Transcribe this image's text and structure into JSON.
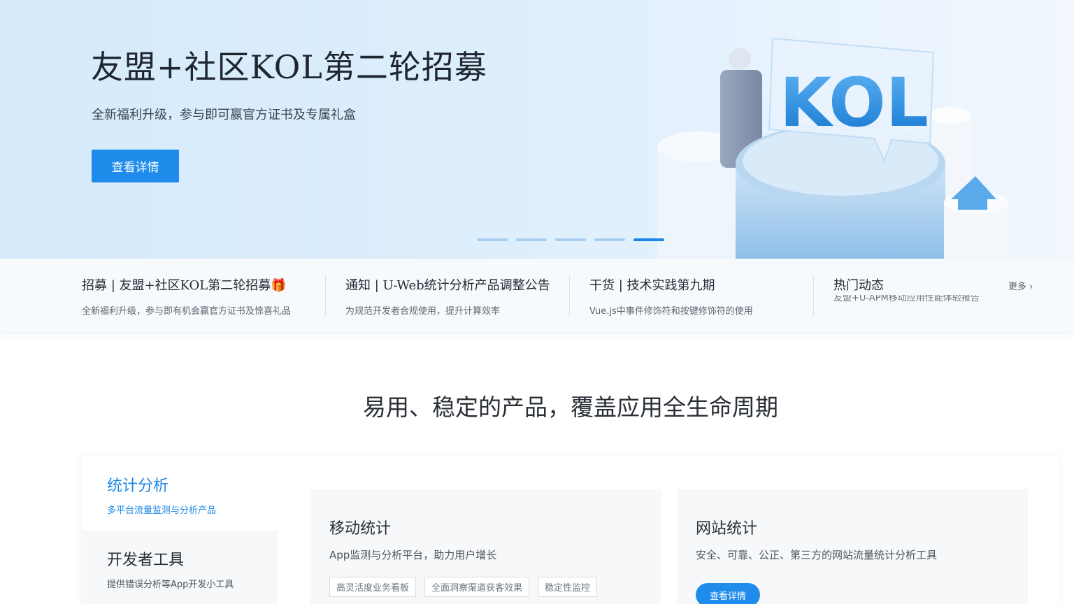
{
  "hero": {
    "title": "友盟+社区KOL第二轮招募",
    "subtitle": "全新福利升级，参与即可赢官方证书及专属礼盒",
    "button_label": "查看详情",
    "art_text": "KOL",
    "slide_count": 5,
    "active_slide": 5
  },
  "news": {
    "items": [
      {
        "title": "招募 | 友盟+社区KOL第二轮招募🎁",
        "desc": "全新福利升级，参与即有机会赢官方证书及惊喜礼品"
      },
      {
        "title": "通知 | U-Web统计分析产品调整公告",
        "desc": "为规范开发者合规使用，提升计算效率"
      },
      {
        "title": "干货 | 技术实践第九期",
        "desc": "Vue.js中事件修饰符和按键修饰符的使用"
      }
    ],
    "hot": {
      "title": "热门动态",
      "scroll_text": "友盟+U-APM移动应用性能体验报告",
      "more_label": "更多 ›"
    }
  },
  "section": {
    "title": "易用、稳定的产品，覆盖应用全生命周期"
  },
  "sidebar": {
    "items": [
      {
        "title": "统计分析",
        "desc": "多平台流量监测与分析产品",
        "active": true
      },
      {
        "title": "开发者工具",
        "desc": "提供错误分析等App开发小工具",
        "active": false
      }
    ]
  },
  "cards": {
    "mobile": {
      "title": "移动统计",
      "desc": "App监测与分析平台，助力用户增长",
      "tags": [
        "高灵活度业务看板",
        "全面洞察渠道获客效果",
        "稳定性监控"
      ]
    },
    "web": {
      "title": "网站统计",
      "desc": "安全、可靠、公正、第三方的网站流量统计分析工具",
      "button_label": "查看详情"
    }
  },
  "colors": {
    "accent": "#1f8ceb",
    "active_dot": "#1a86e6",
    "hero_bg": "#d6eafa"
  }
}
